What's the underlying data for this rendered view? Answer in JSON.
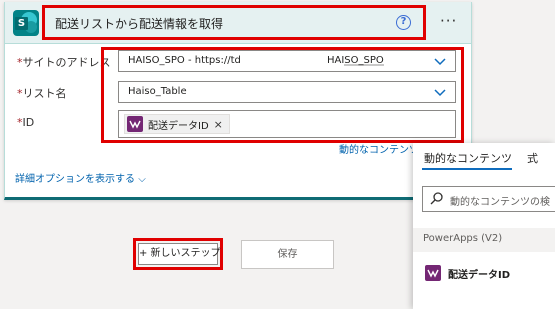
{
  "card": {
    "title": "配送リストから配送情報を取得",
    "help_symbol": "?",
    "more_symbol": "···",
    "sp_letter": "S",
    "fields": [
      {
        "label": "サイトのアドレス",
        "required": "*",
        "value": "HAISO_SPO - https://td",
        "value_tail": "HAISO_SPO"
      },
      {
        "label": "リスト名",
        "required": "*",
        "value": "Haiso_Table"
      },
      {
        "label": "ID",
        "required": "*",
        "token": "配送データID",
        "token_remove": "×"
      }
    ],
    "dynamic_content_link": "動的なコンテンツ",
    "advanced_link": "詳細オプションを表示する"
  },
  "actions": {
    "new_step": "+ 新しいステップ",
    "save": "保存"
  },
  "panel": {
    "tabs": [
      "動的なコンテンツ",
      "式"
    ],
    "search_placeholder": "動的なコンテンツの検",
    "section": "PowerApps (V2)",
    "item": "配送データID"
  },
  "colors": {
    "highlight": "#e00000",
    "header_bg": "#e5f1f1",
    "sharepoint": "#038387",
    "powerapps": "#742774",
    "link": "#0062ad"
  }
}
